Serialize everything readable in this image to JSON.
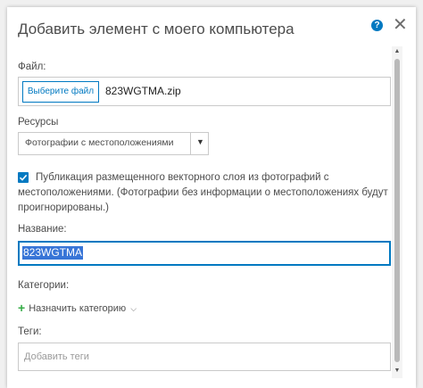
{
  "dialog": {
    "title": "Добавить элемент с моего компьютера"
  },
  "file": {
    "label": "Файл:",
    "button_label": "Выберите файл",
    "file_name": "823WGTMA.zip"
  },
  "resources": {
    "label": "Ресурсы",
    "selected": "Фотографии с местоположениями"
  },
  "publish": {
    "checked": true,
    "text": "Публикация размещенного векторного слоя из фотографий с местоположениями. (Фотографии без информации о местоположениях будут проигнорированы.)"
  },
  "name": {
    "label": "Название:",
    "value": "823WGTMA"
  },
  "categories": {
    "label": "Категории:",
    "assign_label": "Назначить категорию"
  },
  "tags": {
    "label": "Теги:",
    "placeholder": "Добавить теги"
  },
  "icons": {
    "help": "help-icon",
    "close": "close-icon",
    "plus": "plus-icon",
    "chevron": "chevron-down-icon"
  },
  "colors": {
    "accent": "#0079c1",
    "plus": "#35ac46",
    "selection": "#3875d7"
  }
}
